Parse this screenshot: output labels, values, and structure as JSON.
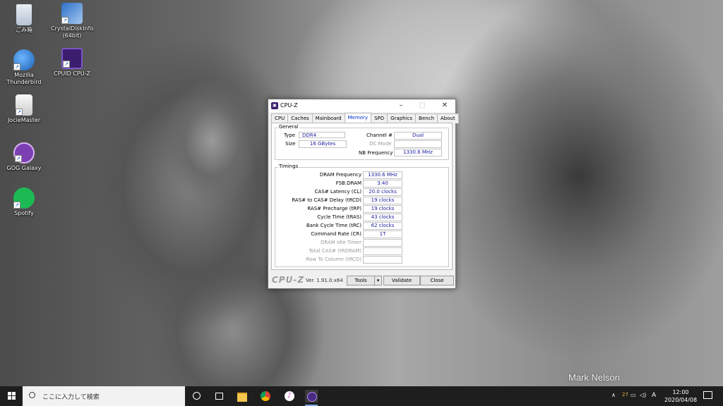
{
  "desktop": {
    "icons": [
      {
        "label": "ごみ箱",
        "icon": "recycle-bin-icon"
      },
      {
        "label": "CrystalDiskInfo (64bit)",
        "icon": "crystaldiskinfo-icon"
      },
      {
        "label": "Mozilla Thunderbird",
        "icon": "thunderbird-icon"
      },
      {
        "label": "CPUID CPU-Z",
        "icon": "cpuz-icon"
      },
      {
        "label": "JocieMaster",
        "icon": "app-icon"
      },
      {
        "label": "GOG Galaxy",
        "icon": "gog-icon"
      },
      {
        "label": "Spotify",
        "icon": "spotify-icon"
      }
    ],
    "watermark": "Mark Nelson"
  },
  "window": {
    "title": "CPU-Z",
    "tabs": [
      "CPU",
      "Caches",
      "Mainboard",
      "Memory",
      "SPD",
      "Graphics",
      "Bench",
      "About"
    ],
    "active_tab": "Memory",
    "general": {
      "title": "General",
      "type_label": "Type",
      "type_value": "DDR4",
      "size_label": "Size",
      "size_value": "16 GBytes",
      "channel_label": "Channel #",
      "channel_value": "Dual",
      "dc_label": "DC Mode",
      "dc_value": "",
      "nb_label": "NB Frequency",
      "nb_value": "1330.6 MHz"
    },
    "timings": {
      "title": "Timings",
      "rows": [
        {
          "label": "DRAM Frequency",
          "value": "1330.6 MHz",
          "enabled": true
        },
        {
          "label": "FSB:DRAM",
          "value": "3:40",
          "enabled": true
        },
        {
          "label": "CAS# Latency (CL)",
          "value": "20.0 clocks",
          "enabled": true
        },
        {
          "label": "RAS# to CAS# Delay (tRCD)",
          "value": "19 clocks",
          "enabled": true
        },
        {
          "label": "RAS# Precharge (tRP)",
          "value": "19 clocks",
          "enabled": true
        },
        {
          "label": "Cycle Time (tRAS)",
          "value": "43 clocks",
          "enabled": true
        },
        {
          "label": "Bank Cycle Time (tRC)",
          "value": "62 clocks",
          "enabled": true
        },
        {
          "label": "Command Rate (CR)",
          "value": "1T",
          "enabled": true
        },
        {
          "label": "DRAM Idle Timer",
          "value": "",
          "enabled": false
        },
        {
          "label": "Total CAS# (tRDRAM)",
          "value": "",
          "enabled": false
        },
        {
          "label": "Row To Column (tRCD)",
          "value": "",
          "enabled": false
        }
      ]
    },
    "footer": {
      "logo": "CPU-Z",
      "version": "Ver. 1.91.0.x64",
      "tools_label": "Tools",
      "validate_label": "Validate",
      "close_label": "Close"
    }
  },
  "taskbar": {
    "search_placeholder": "ここに入力して検索",
    "temperature": "27",
    "ime_mode": "A",
    "time": "12:00",
    "date": "2020/04/08"
  }
}
